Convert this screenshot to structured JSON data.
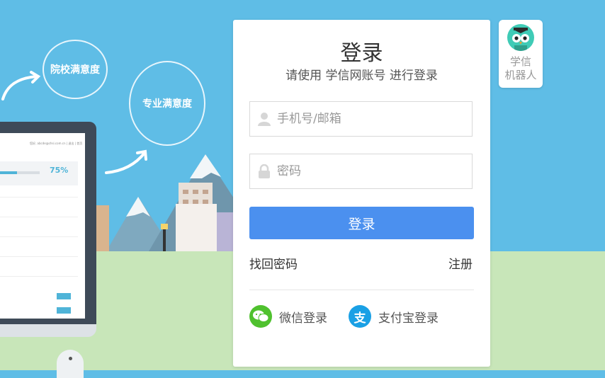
{
  "bubbles": {
    "school_satisfaction": "院校满意度",
    "major_satisfaction": "专业满意度"
  },
  "laptop_screen": {
    "progress_percent": "75%",
    "header_text": "您好, abcde@chsi.com.cn | 退出 | 首页"
  },
  "login_card": {
    "title": "登录",
    "subtitle": "请使用 学信网账号 进行登录",
    "username_placeholder": "手机号/邮箱",
    "password_placeholder": "密码",
    "login_button": "登录",
    "forgot_password": "找回密码",
    "register": "注册",
    "wechat_login": "微信登录",
    "alipay_login": "支付宝登录",
    "icons": {
      "username": "user-icon",
      "password": "lock-icon",
      "wechat": "wechat-icon",
      "alipay": "alipay-icon"
    }
  },
  "robot": {
    "label_line1": "学信",
    "label_line2": "机器人"
  },
  "colors": {
    "sky": "#5fbde6",
    "ground": "#c8e6b9",
    "primary_button": "#4b90ef",
    "wechat": "#4fc12e",
    "alipay": "#1aa0e5"
  }
}
